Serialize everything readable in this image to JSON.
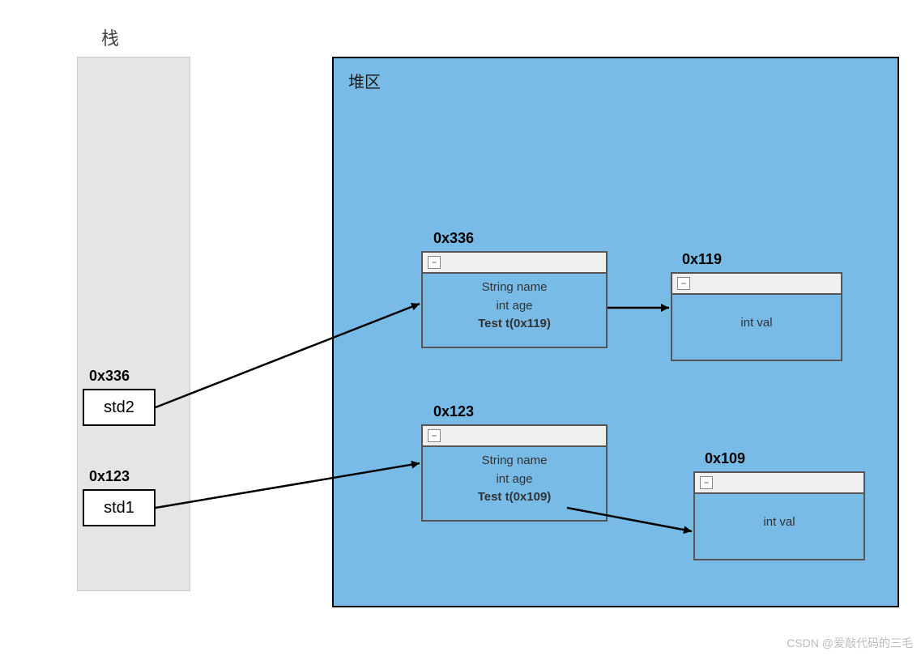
{
  "stack": {
    "title": "栈",
    "vars": [
      {
        "name": "std2",
        "address": "0x336"
      },
      {
        "name": "std1",
        "address": "0x123"
      }
    ]
  },
  "heap": {
    "title": "堆区",
    "objects": [
      {
        "address": "0x336",
        "fields": {
          "line1": "String name",
          "line2": "int age",
          "line3": "Test t(0x119)"
        },
        "points_to": "0x119"
      },
      {
        "address": "0x123",
        "fields": {
          "line1": "String name",
          "line2": "int age",
          "line3": "Test t(0x109)"
        },
        "points_to": "0x109"
      }
    ],
    "tests": [
      {
        "address": "0x119",
        "field": "int val"
      },
      {
        "address": "0x109",
        "field": "int val"
      }
    ]
  },
  "icons": {
    "collapse": "−"
  },
  "watermark": "CSDN @爱敲代码的三毛"
}
